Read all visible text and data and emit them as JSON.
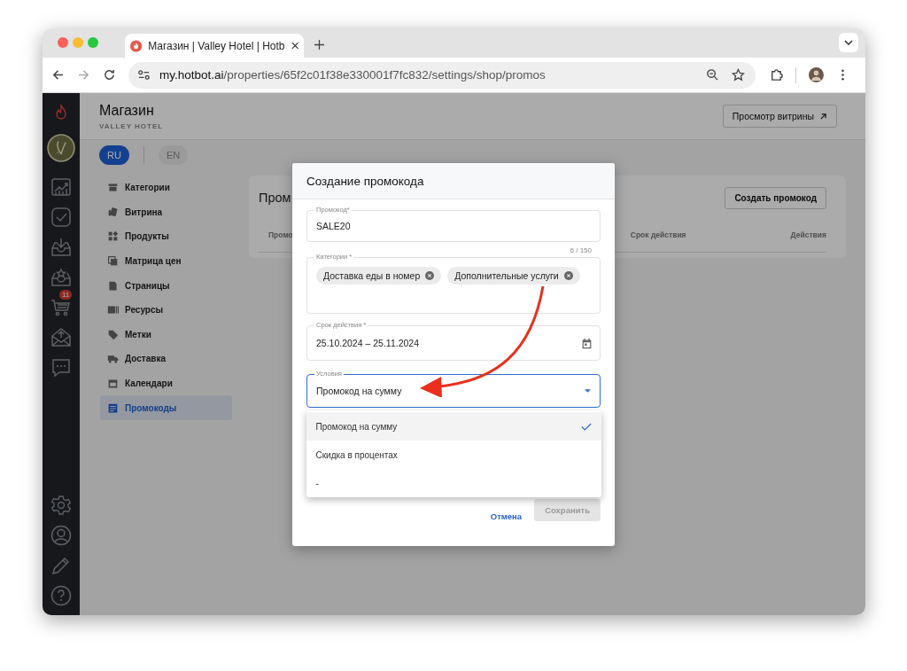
{
  "browser": {
    "tab_title": "Магазин | Valley Hotel | Hotb",
    "url_host": "my.hotbot.ai",
    "url_path": "/properties/65f2c01f38e330001f7fc832/settings/shop/promos"
  },
  "rail": {
    "cart_badge": "11"
  },
  "header": {
    "title": "Магазин",
    "subtitle": "VALLEY HOTEL",
    "storefront_button": "Просмотр витрины"
  },
  "languages": [
    {
      "label": "RU",
      "selected": true
    },
    {
      "label": "EN",
      "selected": false
    }
  ],
  "nav": [
    {
      "label": "Категории",
      "selected": false
    },
    {
      "label": "Витрина",
      "selected": false
    },
    {
      "label": "Продукты",
      "selected": false
    },
    {
      "label": "Матрица цен",
      "selected": false
    },
    {
      "label": "Страницы",
      "selected": false
    },
    {
      "label": "Ресурсы",
      "selected": false
    },
    {
      "label": "Метки",
      "selected": false
    },
    {
      "label": "Доставка",
      "selected": false
    },
    {
      "label": "Календари",
      "selected": false
    },
    {
      "label": "Промокоды",
      "selected": true
    }
  ],
  "panel": {
    "title": "Пром",
    "create_button": "Создать промокод",
    "columns": [
      "Промо",
      "Срок действия",
      "Действия"
    ]
  },
  "modal": {
    "title": "Создание промокода",
    "code_field": {
      "label": "Промокод*",
      "value": "SALE20",
      "counter": "6 / 150"
    },
    "categories_field": {
      "label": "Категории *",
      "chips": [
        "Доставка еды в номер",
        "Дополнительные услуги"
      ]
    },
    "date_field": {
      "label": "Срок действия *",
      "value": "25.10.2024 – 25.11.2024"
    },
    "conditions_field": {
      "label": "Условия",
      "value": "Промокод на сумму",
      "open": true,
      "options": [
        {
          "label": "Промокод на сумму",
          "selected": true
        },
        {
          "label": "Скидка в процентах",
          "selected": false
        },
        {
          "label": "-",
          "selected": false
        }
      ]
    },
    "cancel_button": "Отмена",
    "save_button": {
      "label": "Сохранить",
      "disabled": true
    }
  }
}
